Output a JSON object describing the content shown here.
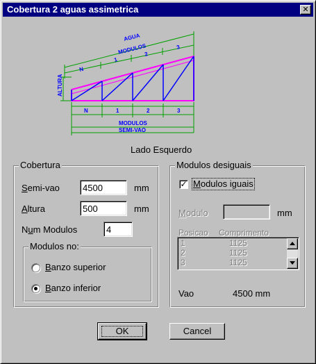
{
  "window": {
    "title": "Cobertura 2 aguas assimetrica",
    "close_glyph": "✕"
  },
  "diagram": {
    "top_label": "AGUA",
    "modules_label": "MODULOS",
    "top_modules": [
      "N",
      "1",
      "2",
      "3"
    ],
    "height_label": "ALTURA",
    "bottom_modules": [
      "N",
      "1",
      "2",
      "3"
    ],
    "bottom_label_1": "MODULOS",
    "bottom_label_2": "SEMI-VAO",
    "colors": {
      "green": "#00a000",
      "magenta": "#ff00ff",
      "blue": "#0000ff"
    }
  },
  "caption": "Lado Esquerdo",
  "cobertura": {
    "legend": "Cobertura",
    "semivao_label": "Semi-vao",
    "semivao_value": "4500",
    "semivao_unit": "mm",
    "altura_label": "Altura",
    "altura_value": "500",
    "altura_unit": "mm",
    "num_modulos_label": "Num Modulos",
    "num_modulos_value": "4",
    "modulos_no": {
      "legend": "Modulos no:",
      "options": [
        {
          "label": "Banzo superior",
          "selected": false
        },
        {
          "label": "Banzo inferior",
          "selected": true
        }
      ]
    }
  },
  "desiguais": {
    "legend": "Modulos desiguais",
    "iguais_label": "Modulos iguais",
    "iguais_checked": true,
    "modulo_label": "Modulo",
    "modulo_value": "",
    "modulo_unit": "mm",
    "list_header_pos": "Posicao",
    "list_header_comp": "Comprimento",
    "rows": [
      {
        "pos": "1",
        "comp": "1125"
      },
      {
        "pos": "2",
        "comp": "1125"
      },
      {
        "pos": "3",
        "comp": "1125"
      }
    ],
    "vao_label": "Vao",
    "vao_value": "4500 mm"
  },
  "buttons": {
    "ok": "OK",
    "cancel": "Cancel"
  }
}
